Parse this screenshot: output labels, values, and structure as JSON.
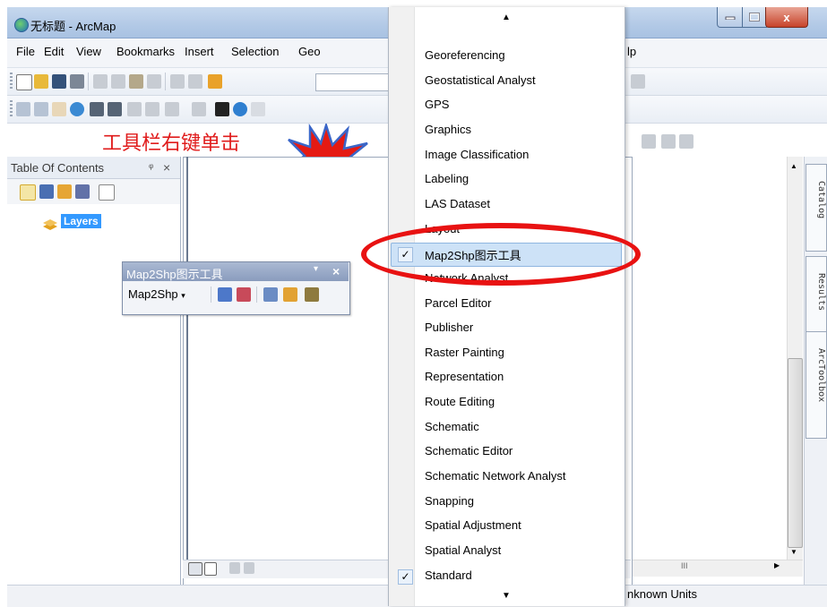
{
  "window": {
    "title": "无标题 - ArcMap",
    "close_glyph": "x"
  },
  "menubar": {
    "items": [
      "File",
      "Edit",
      "View",
      "Bookmarks",
      "Insert",
      "Selection",
      "Geo"
    ],
    "help_fragment": "lp"
  },
  "annotation": {
    "text": "工具栏右键单击"
  },
  "toc": {
    "title": "Table Of Contents",
    "pin_glyph": "ᵠ",
    "close_glyph": "×",
    "layers_label": "Layers"
  },
  "floating_toolbar": {
    "title": "Map2Shp图示工具",
    "dropdown_label": "Map2Shp",
    "pin_glyph": "▾",
    "close_glyph": "×"
  },
  "context_menu": {
    "items": [
      {
        "label": "Georeferencing",
        "checked": false
      },
      {
        "label": "Geostatistical Analyst",
        "checked": false
      },
      {
        "label": "GPS",
        "checked": false
      },
      {
        "label": "Graphics",
        "checked": false
      },
      {
        "label": "Image Classification",
        "checked": false
      },
      {
        "label": "Labeling",
        "checked": false
      },
      {
        "label": "LAS Dataset",
        "checked": false
      },
      {
        "label": "Layout",
        "checked": false
      },
      {
        "label": "Map2Shp图示工具",
        "checked": true,
        "highlighted": true
      },
      {
        "label": "Network Analyst",
        "checked": false
      },
      {
        "label": "Parcel Editor",
        "checked": false
      },
      {
        "label": "Publisher",
        "checked": false
      },
      {
        "label": "Raster Painting",
        "checked": false
      },
      {
        "label": "Representation",
        "checked": false
      },
      {
        "label": "Route Editing",
        "checked": false
      },
      {
        "label": "Schematic",
        "checked": false
      },
      {
        "label": "Schematic Editor",
        "checked": false
      },
      {
        "label": "Schematic Network Analyst",
        "checked": false
      },
      {
        "label": "Snapping",
        "checked": false
      },
      {
        "label": "Spatial Adjustment",
        "checked": false
      },
      {
        "label": "Spatial Analyst",
        "checked": false
      },
      {
        "label": "Standard",
        "checked": true
      }
    ],
    "scroll_up_glyph": "▲",
    "scroll_down_glyph": "▼",
    "check_glyph": "✓"
  },
  "side_tabs": [
    "Catalog",
    "Results",
    "ArcToolbox"
  ],
  "statusbar": {
    "units": "nknown Units"
  },
  "hscroll": {
    "thumb_text": "III"
  },
  "colors": {
    "annotation_red": "#e01b1b",
    "highlight": "#cde2f7",
    "layers_selected": "#3399ff"
  }
}
